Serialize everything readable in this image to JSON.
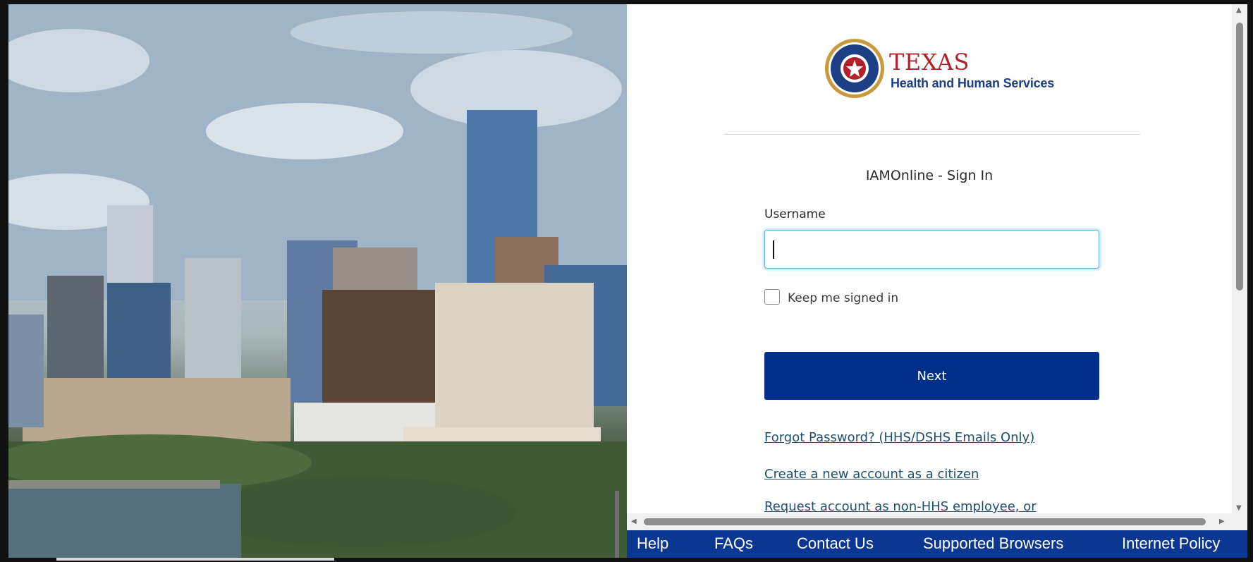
{
  "logo": {
    "brand": "TEXAS",
    "subtitle": "Health and Human Services"
  },
  "page": {
    "title": "IAMOnline - Sign In"
  },
  "form": {
    "username_label": "Username",
    "username_value": "",
    "keep_signed_in_label": "Keep me signed in",
    "keep_signed_in_checked": false,
    "next_label": "Next"
  },
  "links": [
    "Forgot Password? (HHS/DSHS Emails Only)",
    "Create a new account as a citizen",
    "Request account as non-HHS employee, or"
  ],
  "footer": {
    "items": [
      "Help",
      "FAQs",
      "Contact Us",
      "Supported Browsers",
      "Internet Policy"
    ]
  },
  "colors": {
    "primary": "#002f8a",
    "footer_bg": "#0b3792",
    "link": "#1e4f6e",
    "brand_red": "#b3222b",
    "brand_blue": "#1d3f86",
    "focus": "#6db8d8"
  },
  "icons": {
    "seal": "texas-hhs-seal-icon",
    "scroll_up": "triangle-up-icon",
    "scroll_down": "triangle-down-icon",
    "scroll_left": "triangle-left-icon",
    "scroll_right": "triangle-right-icon"
  }
}
